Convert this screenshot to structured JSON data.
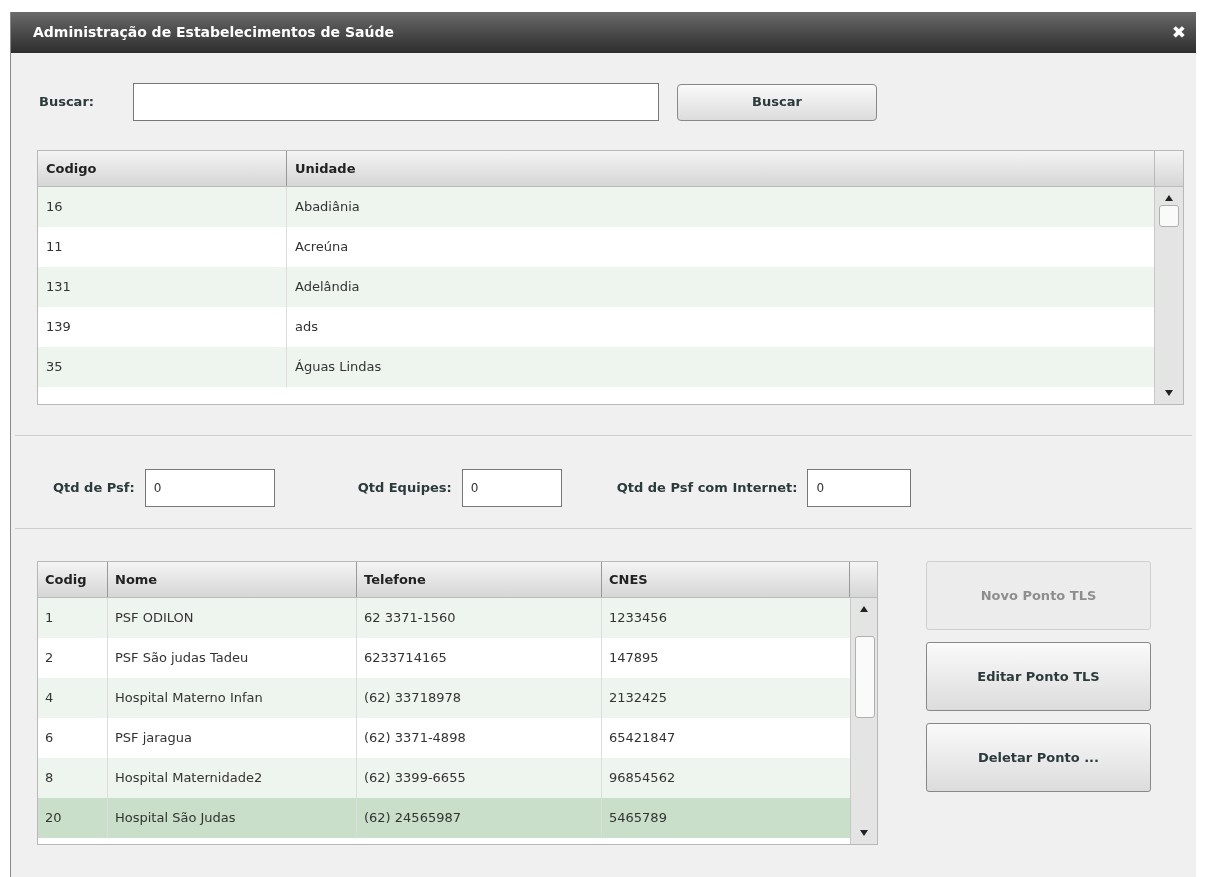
{
  "window": {
    "title": "Administração de Estabelecimentos de Saúde",
    "close": "✖"
  },
  "search": {
    "label": "Buscar:",
    "button": "Buscar"
  },
  "units_table": {
    "columns": [
      "Codigo",
      "Unidade"
    ],
    "rows": [
      {
        "cells": [
          "16",
          "Abadiânia"
        ],
        "selected": false
      },
      {
        "cells": [
          "11",
          "Acreúna"
        ],
        "selected": false
      },
      {
        "cells": [
          "131",
          "Adelândia"
        ],
        "selected": false
      },
      {
        "cells": [
          "139",
          "ads"
        ],
        "selected": false
      },
      {
        "cells": [
          "35",
          "Águas Lindas"
        ],
        "selected": false
      }
    ]
  },
  "counts": [
    {
      "label": "Qtd de Psf:",
      "value": "0"
    },
    {
      "label": "Qtd Equipes:",
      "value": "0"
    },
    {
      "label": "Qtd de Psf com Internet:",
      "value": "0"
    }
  ],
  "points_table": {
    "columns": [
      "Codig",
      "Nome",
      "Telefone",
      "CNES"
    ],
    "rows": [
      {
        "cells": [
          "1",
          "PSF ODILON",
          "62 3371-1560",
          "1233456"
        ],
        "selected": false
      },
      {
        "cells": [
          "2",
          "PSF São judas Tadeu",
          "6233714165",
          "147895"
        ],
        "selected": false
      },
      {
        "cells": [
          "4",
          "Hospital Materno Infan",
          "(62) 33718978",
          "2132425"
        ],
        "selected": false
      },
      {
        "cells": [
          "6",
          "PSF jaragua",
          "(62) 3371-4898",
          "65421847"
        ],
        "selected": false
      },
      {
        "cells": [
          "8",
          "Hospital Maternidade2",
          "(62) 3399-6655",
          "96854562"
        ],
        "selected": false
      },
      {
        "cells": [
          "20",
          "Hospital São Judas",
          "(62) 24565987",
          "5465789"
        ],
        "selected": true
      }
    ]
  },
  "actions": [
    {
      "label": "Novo Ponto TLS",
      "disabled": true
    },
    {
      "label": "Editar Ponto TLS",
      "disabled": false
    },
    {
      "label": "Deletar Ponto ...",
      "disabled": false
    }
  ]
}
